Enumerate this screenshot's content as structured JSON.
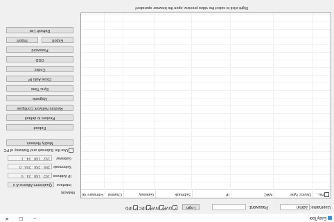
{
  "window": {
    "title": "EasyTool",
    "minimize_glyph": "–",
    "maximize_glyph": "☐",
    "close_glyph": "✕"
  },
  "toolbar": {
    "username_label": "Username:",
    "username_value": "admin",
    "password_label": "Password:",
    "password_value": "",
    "login_label": "Login",
    "checkboxes": [
      {
        "label": "DVR",
        "checked": true
      },
      {
        "label": "NVR",
        "checked": true
      },
      {
        "label": "IPC",
        "checked": true
      },
      {
        "label": "IPD",
        "checked": true
      }
    ]
  },
  "table": {
    "columns": [
      "Nu...",
      "Device Type",
      "MAC",
      "IP",
      "Submask",
      "Gateway",
      "Channel",
      "Firmware Ve"
    ],
    "rows": [],
    "hint": "Right-click to select the video preview, open the browser operation!"
  },
  "network": {
    "section_label": "Network",
    "interface_label": "Interface",
    "interface_value": "Qualcomm Atheros A ∨",
    "ip_label": "IP Address",
    "ip_value": "192 . 168 . 24 . 9",
    "submask_label": "Subnmask",
    "submask_value": "255 . 255 . 255 . 0",
    "gateway_label": "Gateway",
    "gateway_value": "192 . 168 . 24 . 1",
    "use_submask_label": "Use the Submask and Gateway of PC",
    "use_submask_checked": true,
    "modify_label": "Modify Network"
  },
  "actions": {
    "reboot": "Reboot",
    "restore_default": "Restore to default",
    "restore_network": "Restore Network Configure",
    "upgrade": "Upgrade",
    "sync_time": "Sync Time",
    "close_auto_ip": "Close Auto IP",
    "codec": "Codec",
    "osd": "OSD",
    "password": "Password",
    "export": "Export",
    "import": "Import",
    "refresh": "Refresh List"
  }
}
